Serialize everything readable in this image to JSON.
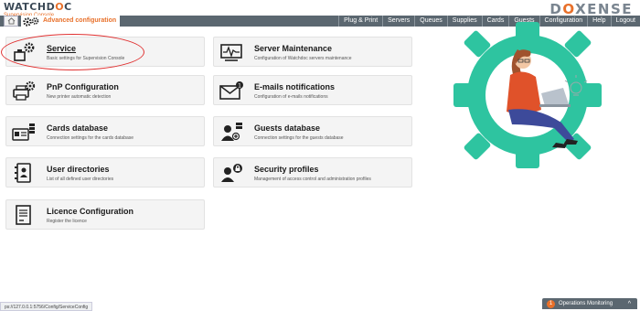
{
  "brand": {
    "logo_pre": "WATCHD",
    "logo_mid": "O",
    "logo_post": "C",
    "subtitle": "Supervision Console",
    "vendor_pre": "D",
    "vendor_mid": "O",
    "vendor_post": "XENSE"
  },
  "header": {
    "section_title": "Advanced configuration"
  },
  "nav": {
    "items": [
      "Plug & Print",
      "Servers",
      "Queues",
      "Supplies",
      "Cards",
      "Guests",
      "Configuration",
      "Help",
      "Logout"
    ]
  },
  "cards": [
    {
      "title": "Service",
      "desc": "Basic settings for Supervision Console",
      "icon": "service-gears-icon"
    },
    {
      "title": "Server Maintenance",
      "desc": "Configuration of Watchdoc servers maintenance",
      "icon": "maintenance-monitor-icon"
    },
    {
      "title": "PnP Configuration",
      "desc": "New printer automatic detection",
      "icon": "printer-gear-icon"
    },
    {
      "title": "E-mails notifications",
      "desc": "Configuration of e-mails notifications",
      "icon": "envelope-icon"
    },
    {
      "title": "Cards database",
      "desc": "Connection settings for the cards database",
      "icon": "card-database-icon"
    },
    {
      "title": "Guests database",
      "desc": "Connection settings for the guests database",
      "icon": "guest-database-icon"
    },
    {
      "title": "User directories",
      "desc": "List of all defined user directories",
      "icon": "address-book-icon"
    },
    {
      "title": "Security profiles",
      "desc": "Management of access control and administration profiles",
      "icon": "user-lock-icon"
    },
    {
      "title": "Licence Configuration",
      "desc": "Register the licence",
      "icon": "licence-document-icon"
    }
  ],
  "status_bar": {
    "url": "ps://127.0.0.1:5756/Config/ServiceConfig"
  },
  "operations": {
    "count": "1",
    "label": "Operations Monitoring",
    "chevron": "^"
  },
  "colors": {
    "accent": "#e8702a",
    "navbar": "#5b6770",
    "gear": "#2ec4a0"
  }
}
